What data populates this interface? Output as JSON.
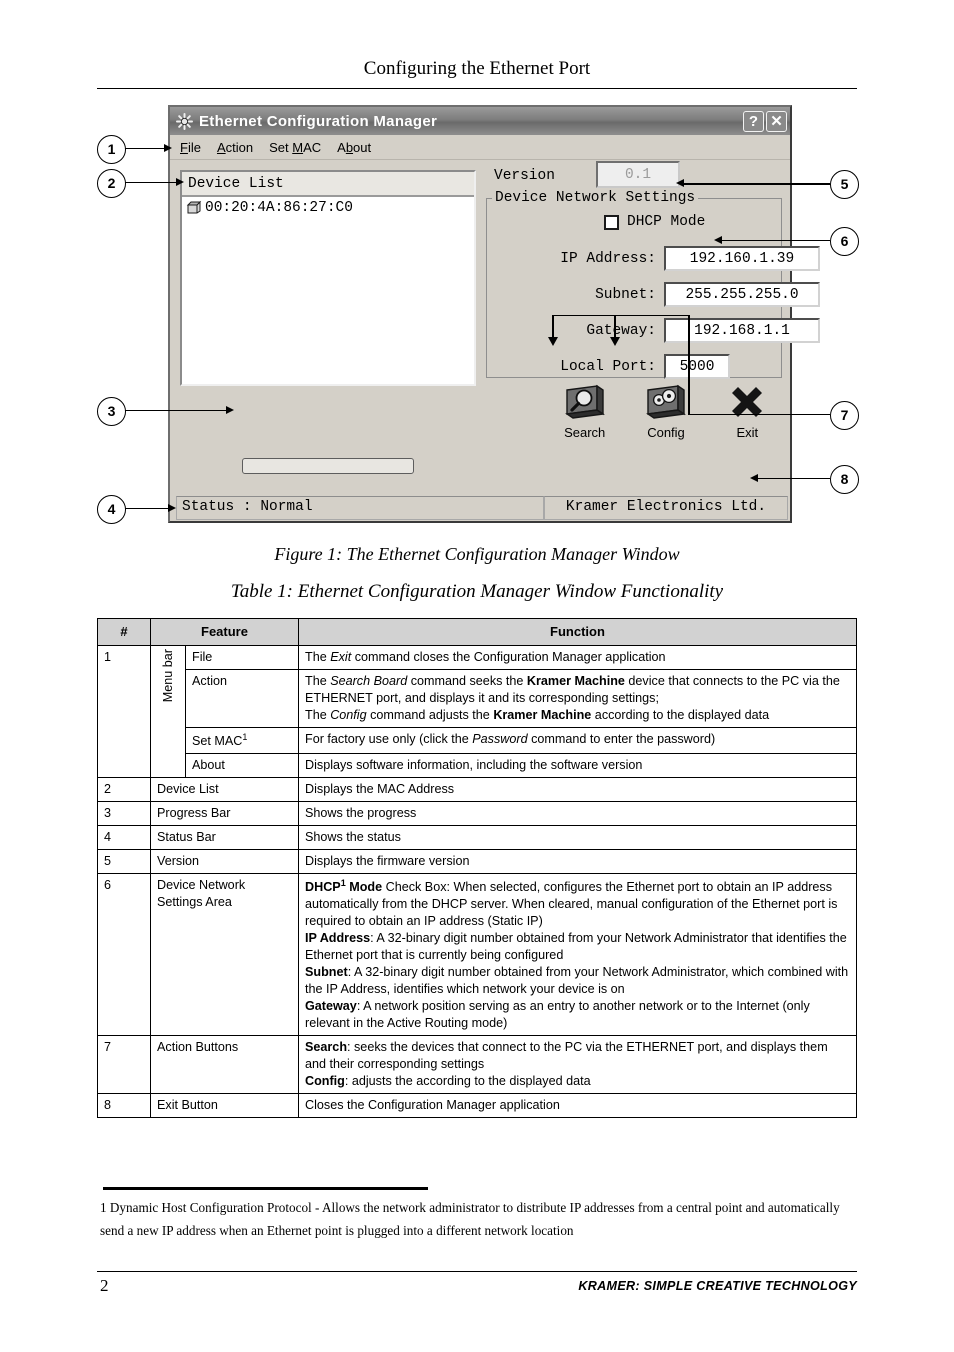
{
  "page": {
    "header_title": "Configuring the Ethernet Port",
    "page_number": "2",
    "footer_brand": "KRAMER:  SIMPLE CREATIVE TECHNOLOGY"
  },
  "app": {
    "title": "Ethernet Configuration Manager",
    "titlebar_buttons": {
      "help": "?",
      "close": "✕"
    },
    "menu": [
      {
        "label": "File",
        "accel_index": 0
      },
      {
        "label": "Action",
        "accel_index": 0
      },
      {
        "label": "Set MAC",
        "accel_index": 4
      },
      {
        "label": "About",
        "accel_index": 1
      }
    ],
    "device_list": {
      "header": "Device List",
      "items": [
        "00:20:4A:86:27:C0"
      ]
    },
    "version": {
      "label": "Version",
      "value": "0.1"
    },
    "group": {
      "title": "Device Network Settings",
      "dhcp": {
        "label": "DHCP Mode",
        "checked": false
      },
      "fields": [
        {
          "label": "IP Address:",
          "value": "192.160.1.39"
        },
        {
          "label": "Subnet:",
          "value": "255.255.255.0"
        },
        {
          "label": "Gateway:",
          "value": "192.168.1.1"
        },
        {
          "label": "Local Port:",
          "value": "5000"
        }
      ]
    },
    "action_buttons": [
      {
        "caption": "Search",
        "icon": "monitor-search-icon"
      },
      {
        "caption": "Config",
        "icon": "monitor-gears-icon"
      },
      {
        "caption": "Exit",
        "icon": "x-cross-icon"
      }
    ],
    "statusbar": {
      "left": "Status : Normal",
      "right": "Kramer Electronics Ltd."
    },
    "progress": {
      "value": 0
    }
  },
  "callouts": [
    {
      "n": "1"
    },
    {
      "n": "2"
    },
    {
      "n": "3"
    },
    {
      "n": "4"
    },
    {
      "n": "5"
    },
    {
      "n": "6"
    },
    {
      "n": "7"
    },
    {
      "n": "8"
    }
  ],
  "captions": {
    "figure": "Figure 1: The Ethernet Configuration Manager Window",
    "table": "Table 1: Ethernet Configuration Manager Window Functionality"
  },
  "table": {
    "headers": [
      "#",
      "Feature",
      "Function"
    ],
    "menu_bar_label": "Menu bar",
    "rows": [
      {
        "num": "1",
        "sub_feature": "File",
        "function_html": "The <span class=\"it\">Exit</span> command closes the Configuration Manager application"
      },
      {
        "num": "",
        "sub_feature": "Action",
        "function_html": "The <span class=\"it\">Search Board</span> command seeks the <span class=\"bd\">Kramer Machine</span> device that connects to the PC via the ETHERNET port, and displays it and its corresponding settings;<br>The <span class=\"it\">Config</span> command adjusts the <span class=\"bd\">Kramer Machine</span> according to the displayed data"
      },
      {
        "num": "",
        "sub_feature_html": "Set MAC<sup>1</sup>",
        "function_html": "For factory use only (click the <span class=\"it\">Password</span> command to enter the password)"
      },
      {
        "num": "",
        "sub_feature": "About",
        "function_html": "Displays software information, including the software version"
      },
      {
        "num": "2",
        "feature": "Device List",
        "function_html": "Displays the MAC Address"
      },
      {
        "num": "3",
        "feature": "Progress Bar",
        "function_html": "Shows the progress"
      },
      {
        "num": "4",
        "feature": "Status Bar",
        "function_html": "Shows the status"
      },
      {
        "num": "5",
        "feature": "Version",
        "function_html": "Displays the firmware version"
      },
      {
        "num": "6",
        "feature": "Device Network Settings Area",
        "function_html": "<span class=\"bd\">DHCP<sup>1</sup> Mode</span> Check Box: When selected, configures the Ethernet port to obtain an IP address automatically from the DHCP server. When cleared, manual configuration of the Ethernet port is required to obtain an IP address (Static IP)<br><span class=\"bd\">IP Address</span>: A 32-binary digit number obtained from your Network Administrator that identifies the Ethernet port that is currently being configured<br><span class=\"bd\">Subnet</span>: A 32-binary digit number obtained from your Network Administrator, which combined with the IP Address, identifies which network your device is on<br><span class=\"bd\">Gateway</span>: A network position serving as an entry to another network or to the Internet (only relevant in the Active Routing mode)"
      },
      {
        "num": "7",
        "feature": "Action Buttons",
        "function_html": "<span class=\"bd\">Search</span>: seeks the devices that connect to the PC via the ETHERNET port, and displays them and their corresponding settings<br><span class=\"bd\">Config</span>: adjusts the according to the displayed data"
      },
      {
        "num": "8",
        "feature": "Exit Button",
        "function_html": "Closes the Configuration Manager application"
      }
    ]
  },
  "footnote": "1 Dynamic Host Configuration Protocol - Allows the network administrator to distribute IP addresses from a central point and automatically send a new IP address when an Ethernet point is plugged into a different network location"
}
